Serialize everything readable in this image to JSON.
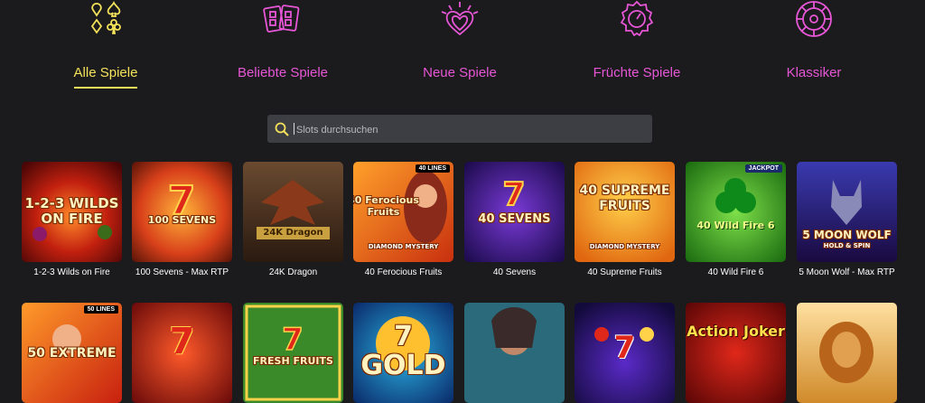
{
  "categories": [
    {
      "label": "Alle Spiele",
      "icon": "card-suits-icon",
      "active": true
    },
    {
      "label": "Beliebte Spiele",
      "icon": "cards-icon",
      "active": false
    },
    {
      "label": "Neue Spiele",
      "icon": "heart-sparkle-icon",
      "active": false
    },
    {
      "label": "Früchte Spiele",
      "icon": "dial-icon",
      "active": false
    },
    {
      "label": "Klassiker",
      "icon": "roulette-icon",
      "active": false
    }
  ],
  "search": {
    "placeholder": "Slots durchsuchen"
  },
  "games_row1": [
    {
      "name": "1-2-3 Wilds on Fire",
      "art": "1-2-3 WILDS ON FIRE"
    },
    {
      "name": "100 Sevens - Max RTP",
      "art": "100 SEVENS"
    },
    {
      "name": "24K Dragon",
      "art": "24K Dragon"
    },
    {
      "name": "40 Ferocious Fruits",
      "art": "40 Ferocious Fruits",
      "badge": "40 LINES",
      "sub": "DIAMOND MYSTERY"
    },
    {
      "name": "40 Sevens",
      "art": "40 SEVENS"
    },
    {
      "name": "40 Supreme Fruits",
      "art": "40 SUPREME FRUITS",
      "sub": "DIAMOND MYSTERY"
    },
    {
      "name": "40 Wild Fire 6",
      "art": "40 Wild Fire 6",
      "badge": "JACKPOT"
    },
    {
      "name": "5 Moon Wolf - Max RTP",
      "art": "5 MOON WOLF",
      "sub": "HOLD & SPIN"
    }
  ],
  "games_row2": [
    {
      "art": "50 EXTREME",
      "badge": "50 LINES"
    },
    {
      "art": "7"
    },
    {
      "art": "FRESH FRUITS"
    },
    {
      "art": "7 GOLD"
    },
    {
      "art": ""
    },
    {
      "art": "7"
    },
    {
      "art": "Action Joker"
    },
    {
      "art": ""
    }
  ],
  "colors": {
    "accent_active": "#f4e25a",
    "accent": "#e756d6",
    "background": "#1b1b1d",
    "search_bg": "#3d3d44"
  }
}
